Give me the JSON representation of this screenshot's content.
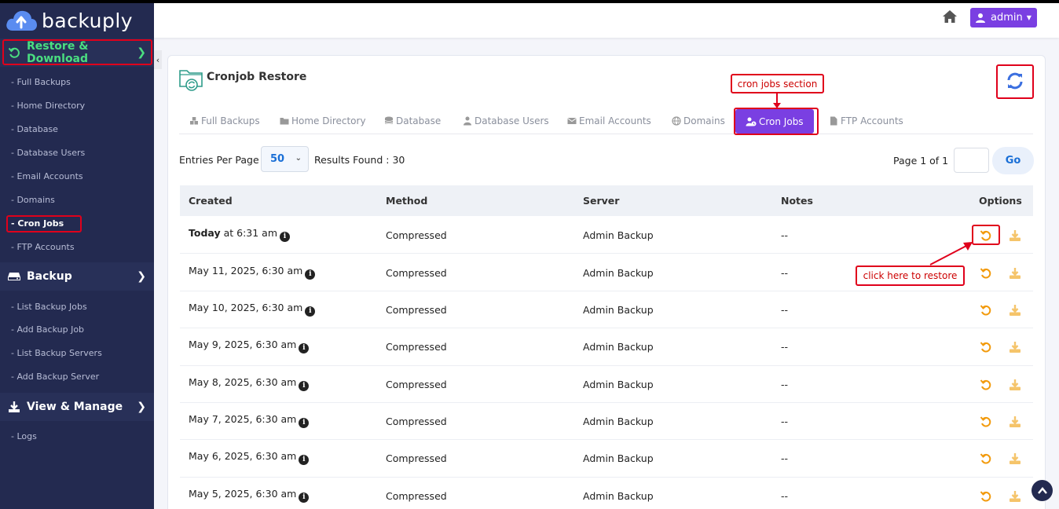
{
  "app": {
    "name": "backuply"
  },
  "sidebar": {
    "restore_section": {
      "label": "Restore & Download"
    },
    "restore_items": [
      {
        "label": "- Full Backups"
      },
      {
        "label": "- Home Directory"
      },
      {
        "label": "- Database"
      },
      {
        "label": "- Database Users"
      },
      {
        "label": "- Email Accounts"
      },
      {
        "label": "- Domains"
      },
      {
        "label": "- Cron Jobs"
      },
      {
        "label": "- FTP Accounts"
      }
    ],
    "backup_section": {
      "label": "Backup"
    },
    "backup_items": [
      {
        "label": "- List Backup Jobs"
      },
      {
        "label": "- Add Backup Job"
      },
      {
        "label": "- List Backup Servers"
      },
      {
        "label": "- Add Backup Server"
      }
    ],
    "view_section": {
      "label": "View & Manage"
    },
    "view_items": [
      {
        "label": "- Logs"
      }
    ],
    "collapse_glyph": "‹"
  },
  "topbar": {
    "user_label": "admin"
  },
  "main": {
    "title": "Cronjob Restore",
    "tabs": [
      {
        "label": "Full Backups"
      },
      {
        "label": "Home Directory"
      },
      {
        "label": "Database"
      },
      {
        "label": "Database Users"
      },
      {
        "label": "Email Accounts"
      },
      {
        "label": "Domains"
      },
      {
        "label": "Cron Jobs"
      },
      {
        "label": "FTP Accounts"
      }
    ],
    "entries_label": "Entries Per Page",
    "entries_value": "50",
    "results_label": "Results Found : 30",
    "page_info": "Page 1 of 1",
    "page_input_value": "",
    "go_label": "Go"
  },
  "annotations": {
    "cron_section": "cron jobs section",
    "restore_hint": "click here to restore"
  },
  "table": {
    "headers": {
      "created": "Created",
      "method": "Method",
      "server": "Server",
      "notes": "Notes",
      "options": "Options"
    },
    "rows": [
      {
        "created_bold": "Today",
        "created": " at 6:31 am",
        "method": "Compressed",
        "server": "Admin Backup",
        "notes": "--"
      },
      {
        "created_bold": "",
        "created": "May 11, 2025, 6:30 am",
        "method": "Compressed",
        "server": "Admin Backup",
        "notes": "--"
      },
      {
        "created_bold": "",
        "created": "May 10, 2025, 6:30 am",
        "method": "Compressed",
        "server": "Admin Backup",
        "notes": "--"
      },
      {
        "created_bold": "",
        "created": "May 9, 2025, 6:30 am",
        "method": "Compressed",
        "server": "Admin Backup",
        "notes": "--"
      },
      {
        "created_bold": "",
        "created": "May 8, 2025, 6:30 am",
        "method": "Compressed",
        "server": "Admin Backup",
        "notes": "--"
      },
      {
        "created_bold": "",
        "created": "May 7, 2025, 6:30 am",
        "method": "Compressed",
        "server": "Admin Backup",
        "notes": "--"
      },
      {
        "created_bold": "",
        "created": "May 6, 2025, 6:30 am",
        "method": "Compressed",
        "server": "Admin Backup",
        "notes": "--"
      },
      {
        "created_bold": "",
        "created": "May 5, 2025, 6:30 am",
        "method": "Compressed",
        "server": "Admin Backup",
        "notes": "--"
      }
    ]
  },
  "colors": {
    "sidebar_bg": "#232a50",
    "accent_purple": "#7a3fe2",
    "active_green": "#4ade80",
    "annotation_red": "#e0001b",
    "restore_orange": "#f29a0c",
    "download_orange": "#f5c46a",
    "refresh_blue": "#3b6fe0"
  },
  "icons": {
    "logo": "cloud-upload-icon",
    "restore_section": "undo-icon",
    "backup_section": "hdd-icon",
    "view_section": "download-icon",
    "home": "home-icon",
    "refresh": "refresh-icon",
    "row_restore": "restore-icon",
    "row_download": "download-icon",
    "info": "info-icon",
    "scroll_top": "chevron-up-icon"
  }
}
